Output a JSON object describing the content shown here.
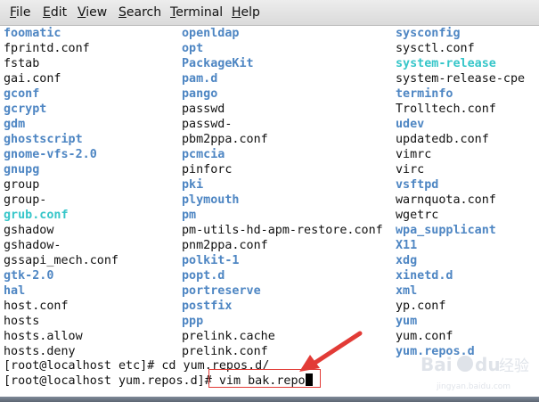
{
  "menu": [
    {
      "mnemonic": "F",
      "rest": "ile"
    },
    {
      "mnemonic": "E",
      "rest": "dit"
    },
    {
      "mnemonic": "V",
      "rest": "iew"
    },
    {
      "mnemonic": "S",
      "rest": "earch"
    },
    {
      "mnemonic": "T",
      "rest": "erminal"
    },
    {
      "mnemonic": "H",
      "rest": "elp"
    }
  ],
  "colors": {
    "directory": "#4e86c3",
    "symlink": "#36c6c9",
    "file": "#111111",
    "annotation": "#e23b36"
  },
  "listing": [
    [
      {
        "name": "foomatic",
        "type": "dir"
      },
      {
        "name": "fprintd.conf",
        "type": "file"
      },
      {
        "name": "fstab",
        "type": "file"
      },
      {
        "name": "gai.conf",
        "type": "file"
      },
      {
        "name": "gconf",
        "type": "dir"
      },
      {
        "name": "gcrypt",
        "type": "dir"
      },
      {
        "name": "gdm",
        "type": "dir"
      },
      {
        "name": "ghostscript",
        "type": "dir"
      },
      {
        "name": "gnome-vfs-2.0",
        "type": "dir"
      },
      {
        "name": "gnupg",
        "type": "dir"
      },
      {
        "name": "group",
        "type": "file"
      },
      {
        "name": "group-",
        "type": "file"
      },
      {
        "name": "grub.conf",
        "type": "link"
      },
      {
        "name": "gshadow",
        "type": "file"
      },
      {
        "name": "gshadow-",
        "type": "file"
      },
      {
        "name": "gssapi_mech.conf",
        "type": "file"
      },
      {
        "name": "gtk-2.0",
        "type": "dir"
      },
      {
        "name": "hal",
        "type": "dir"
      },
      {
        "name": "host.conf",
        "type": "file"
      },
      {
        "name": "hosts",
        "type": "file"
      },
      {
        "name": "hosts.allow",
        "type": "file"
      },
      {
        "name": "hosts.deny",
        "type": "file"
      }
    ],
    [
      {
        "name": "openldap",
        "type": "dir"
      },
      {
        "name": "opt",
        "type": "dir"
      },
      {
        "name": "PackageKit",
        "type": "dir"
      },
      {
        "name": "pam.d",
        "type": "dir"
      },
      {
        "name": "pango",
        "type": "dir"
      },
      {
        "name": "passwd",
        "type": "file"
      },
      {
        "name": "passwd-",
        "type": "file"
      },
      {
        "name": "pbm2ppa.conf",
        "type": "file"
      },
      {
        "name": "pcmcia",
        "type": "dir"
      },
      {
        "name": "pinforc",
        "type": "file"
      },
      {
        "name": "pki",
        "type": "dir"
      },
      {
        "name": "plymouth",
        "type": "dir"
      },
      {
        "name": "pm",
        "type": "dir"
      },
      {
        "name": "pm-utils-hd-apm-restore.conf",
        "type": "file"
      },
      {
        "name": "pnm2ppa.conf",
        "type": "file"
      },
      {
        "name": "polkit-1",
        "type": "dir"
      },
      {
        "name": "popt.d",
        "type": "dir"
      },
      {
        "name": "portreserve",
        "type": "dir"
      },
      {
        "name": "postfix",
        "type": "dir"
      },
      {
        "name": "ppp",
        "type": "dir"
      },
      {
        "name": "prelink.cache",
        "type": "file"
      },
      {
        "name": "prelink.conf",
        "type": "file"
      }
    ],
    [
      {
        "name": "sysconfig",
        "type": "dir"
      },
      {
        "name": "sysctl.conf",
        "type": "file"
      },
      {
        "name": "system-release",
        "type": "link"
      },
      {
        "name": "system-release-cpe",
        "type": "file"
      },
      {
        "name": "terminfo",
        "type": "dir"
      },
      {
        "name": "Trolltech.conf",
        "type": "file"
      },
      {
        "name": "udev",
        "type": "dir"
      },
      {
        "name": "updatedb.conf",
        "type": "file"
      },
      {
        "name": "vimrc",
        "type": "file"
      },
      {
        "name": "virc",
        "type": "file"
      },
      {
        "name": "vsftpd",
        "type": "dir"
      },
      {
        "name": "warnquota.conf",
        "type": "file"
      },
      {
        "name": "wgetrc",
        "type": "file"
      },
      {
        "name": "wpa_supplicant",
        "type": "dir"
      },
      {
        "name": "X11",
        "type": "dir"
      },
      {
        "name": "xdg",
        "type": "dir"
      },
      {
        "name": "xinetd.d",
        "type": "dir"
      },
      {
        "name": "xml",
        "type": "dir"
      },
      {
        "name": "yp.conf",
        "type": "file"
      },
      {
        "name": "yum",
        "type": "dir"
      },
      {
        "name": "yum.conf",
        "type": "file"
      },
      {
        "name": "yum.repos.d",
        "type": "dir"
      }
    ]
  ],
  "prompts": [
    "[root@localhost etc]# cd yum.repos.d/",
    "[root@localhost yum.repos.d]# vim bak.repo"
  ],
  "icons": {
    "annotation": "red-arrow-icon",
    "watermark": "baidu-jingyan-watermark"
  },
  "watermark": {
    "brand": "Bai",
    "paw": "du",
    "product": "经验",
    "url": "jingyan.baidu.com"
  }
}
